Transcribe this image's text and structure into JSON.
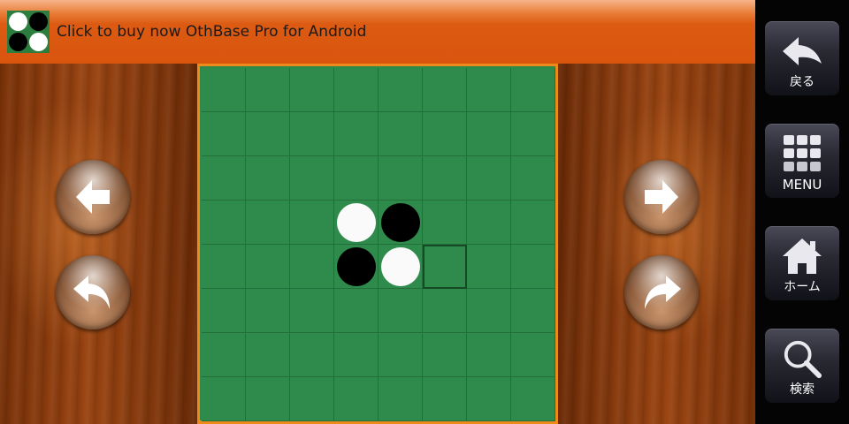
{
  "banner": {
    "text": "Click to buy now OthBase Pro for Android"
  },
  "board": {
    "size": 8,
    "cells": [
      [
        0,
        0,
        0,
        0,
        0,
        0,
        0,
        0
      ],
      [
        0,
        0,
        0,
        0,
        0,
        0,
        0,
        0
      ],
      [
        0,
        0,
        0,
        0,
        0,
        0,
        0,
        0
      ],
      [
        0,
        0,
        0,
        2,
        1,
        0,
        0,
        0
      ],
      [
        0,
        0,
        0,
        1,
        2,
        0,
        0,
        0
      ],
      [
        0,
        0,
        0,
        0,
        0,
        0,
        0,
        0
      ],
      [
        0,
        0,
        0,
        0,
        0,
        0,
        0,
        0
      ],
      [
        0,
        0,
        0,
        0,
        0,
        0,
        0,
        0
      ]
    ],
    "cell_legend": {
      "0": "empty",
      "1": "black",
      "2": "white"
    },
    "highlighted_cell": [
      4,
      5
    ],
    "colors": {
      "board": "#2f8b4c",
      "grid": "#246e3b",
      "frame": "#ee8a1a"
    }
  },
  "nav": {
    "left": [
      {
        "name": "prev-move-button",
        "icon": "arrow-left-icon"
      },
      {
        "name": "undo-button",
        "icon": "curved-arrow-left-icon"
      }
    ],
    "right": [
      {
        "name": "next-move-button",
        "icon": "arrow-right-icon"
      },
      {
        "name": "redo-button",
        "icon": "curved-arrow-right-icon"
      }
    ]
  },
  "side": {
    "back": {
      "label": "戻る",
      "icon": "back-arrow-icon"
    },
    "menu": {
      "label": "MENU",
      "icon": "grid-menu-icon"
    },
    "home": {
      "label": "ホーム",
      "icon": "house-icon"
    },
    "search": {
      "label": "検索",
      "icon": "magnifier-icon"
    }
  }
}
